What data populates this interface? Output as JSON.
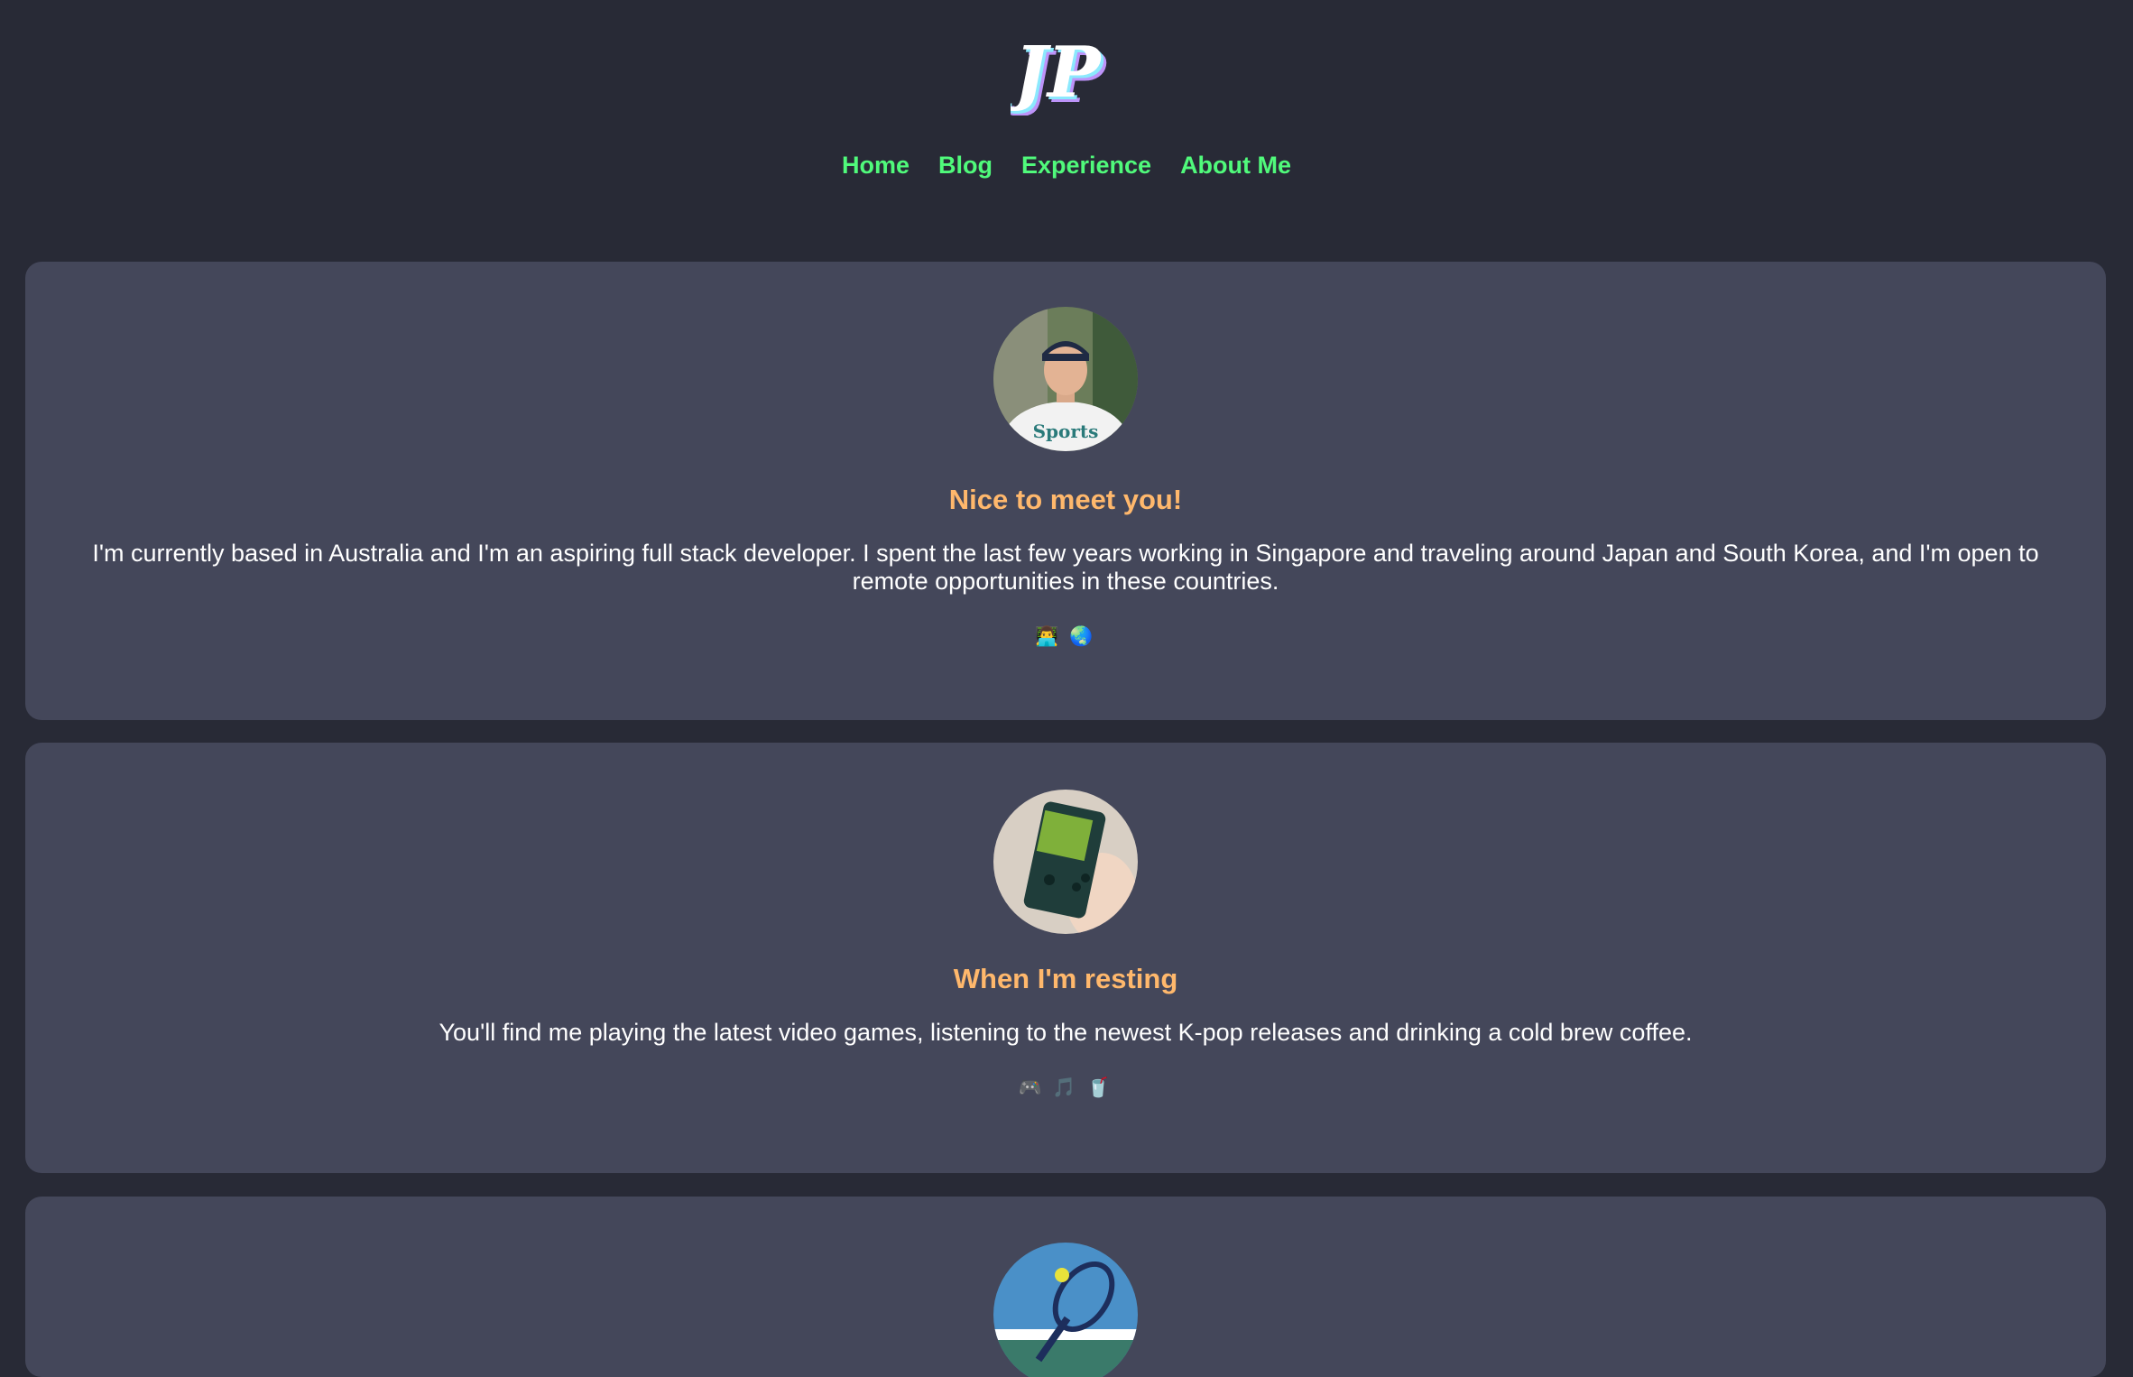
{
  "nav": {
    "items": [
      {
        "label": "Home"
      },
      {
        "label": "Blog"
      },
      {
        "label": "Experience"
      },
      {
        "label": "About Me"
      }
    ]
  },
  "cards": [
    {
      "title": "Nice to meet you!",
      "text": "I'm currently based in Australia and I'm an aspiring full stack developer. I spent the last few years working in Singapore and traveling around Japan and South Korea, and I'm open to remote opportunities in these countries.",
      "emojis": "👨‍💻 🌏",
      "image_icon": "profile-photo"
    },
    {
      "title": "When I'm resting",
      "text": "You'll find me playing the latest video games, listening to the newest K-pop releases and drinking a cold brew coffee.",
      "emojis": "🎮 🎵 🥤",
      "image_icon": "gameboy-photo"
    },
    {
      "title": "",
      "text": "",
      "emojis": "",
      "image_icon": "tennis-racket-photo"
    }
  ],
  "colors": {
    "background": "#282a36",
    "card": "#44475a",
    "nav_link": "#50fa7b",
    "heading": "#ffb86c",
    "text": "#ffffff"
  }
}
